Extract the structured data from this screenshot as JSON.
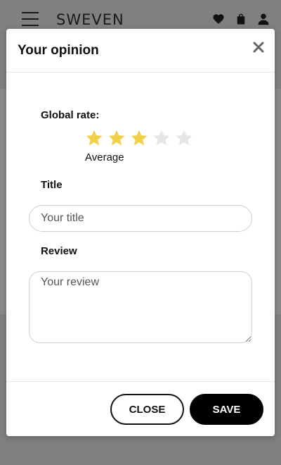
{
  "header": {
    "brand": "SWEVEN",
    "icons": [
      "menu-icon",
      "heart-icon",
      "bag-icon",
      "user-icon"
    ]
  },
  "modal": {
    "title": "Your opinion",
    "global_rate_label": "Global rate:",
    "rating": {
      "value": 3,
      "max": 5,
      "text": "Average"
    },
    "title_label": "Title",
    "title_placeholder": "Your title",
    "title_value": "",
    "review_label": "Review",
    "review_placeholder": "Your review",
    "review_value": "",
    "close_label": "CLOSE",
    "save_label": "SAVE"
  },
  "colors": {
    "star_filled": "#F2CF4A",
    "star_empty": "#E6E6E6",
    "overlay": "#808080"
  }
}
